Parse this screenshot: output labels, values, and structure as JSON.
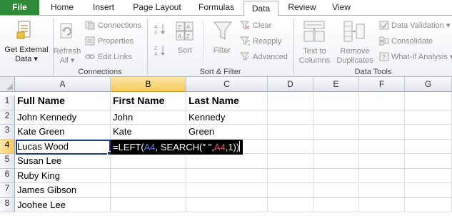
{
  "tabs": {
    "file": "File",
    "home": "Home",
    "insert": "Insert",
    "page_layout": "Page Layout",
    "formulas": "Formulas",
    "data": "Data",
    "review": "Review",
    "view": "View"
  },
  "ribbon": {
    "get_external_data": {
      "line1": "Get External",
      "line2": "Data ▾"
    },
    "connections_group": {
      "refresh_all_line1": "Refresh",
      "refresh_all_line2": "All ▾",
      "connections": "Connections",
      "properties": "Properties",
      "edit_links": "Edit Links",
      "label": "Connections"
    },
    "sort_filter_group": {
      "sort": "Sort",
      "filter": "Filter",
      "clear": "Clear",
      "reapply": "Reapply",
      "advanced": "Advanced",
      "label": "Sort & Filter"
    },
    "data_tools_group": {
      "text_to_columns_line1": "Text to",
      "text_to_columns_line2": "Columns",
      "remove_duplicates_line1": "Remove",
      "remove_duplicates_line2": "Duplicates",
      "data_validation": "Data Validation ▾",
      "consolidate": "Consolidate",
      "what_if": "What-If Analysis ▾",
      "label": "Data Tools"
    }
  },
  "grid": {
    "columns": [
      "A",
      "B",
      "C",
      "D",
      "E",
      "F",
      "G"
    ],
    "rows": [
      "1",
      "2",
      "3",
      "4",
      "5",
      "6",
      "7",
      "8"
    ],
    "cells": {
      "A1": "Full Name",
      "B1": "First Name",
      "C1": "Last Name",
      "A2": "John Kennedy",
      "B2": "John",
      "C2": "Kennedy",
      "A3": "Kate Green",
      "B3": "Kate",
      "C3": "Green",
      "A4": "Lucas Wood",
      "A5": "Susan Lee",
      "A6": "Ruby King",
      "A7": "James Gibson",
      "A8": "Joohee Lee"
    },
    "selected_column": "B",
    "selected_row": "4"
  },
  "formula": {
    "p1": "=LEFT(",
    "ref1": "A4",
    "p2": ", SEARCH(\" \",",
    "ref2": "A4",
    "p3": ",1))"
  },
  "colors": {
    "file_tab": "#2e8a37",
    "selection_border": "#1c3d7d",
    "header_highlight": "#f7c95c",
    "formula_ref_blue": "#5b7fe6",
    "formula_ref_red": "#e85a5a"
  }
}
